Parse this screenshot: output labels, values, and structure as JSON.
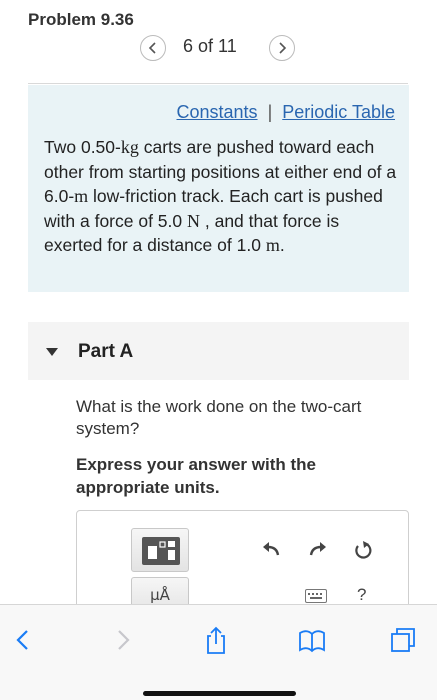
{
  "header": {
    "problem_title": "Problem 9.36"
  },
  "pager": {
    "count": "6 of 11",
    "prev_icon": "chevron-left-icon",
    "next_icon": "chevron-right-icon"
  },
  "info": {
    "constants_link": "Constants",
    "separator": "|",
    "periodic_link": "Periodic Table",
    "text": {
      "p1": "Two 0.50-",
      "u_kg": "kg",
      "p2": " carts are pushed toward each other from starting positions at either end of a 6.0-",
      "u_m1": "m",
      "p3": " low-friction track. Each cart is pushed with a force of 5.0  ",
      "u_n": "N",
      "p4": " , and that force is exerted for a distance of 1.0 ",
      "u_m2": "m",
      "p5": "."
    }
  },
  "part": {
    "title": "Part A",
    "question": "What is the work done on the two-cart system?",
    "instruction": "Express your answer with the appropriate units."
  },
  "answer_toolbar": {
    "units_label": "μÅ",
    "help_label": "?",
    "icons": [
      "templates-icon",
      "undo-icon",
      "redo-icon",
      "reset-icon",
      "keyboard-icon"
    ]
  },
  "browser_bar": {
    "icons": [
      "back-arrow-icon",
      "forward-arrow-icon",
      "share-icon",
      "bookmarks-icon",
      "tabs-icon"
    ],
    "accent_color": "#1a7cf5",
    "disabled_color": "#c7c7cc"
  }
}
